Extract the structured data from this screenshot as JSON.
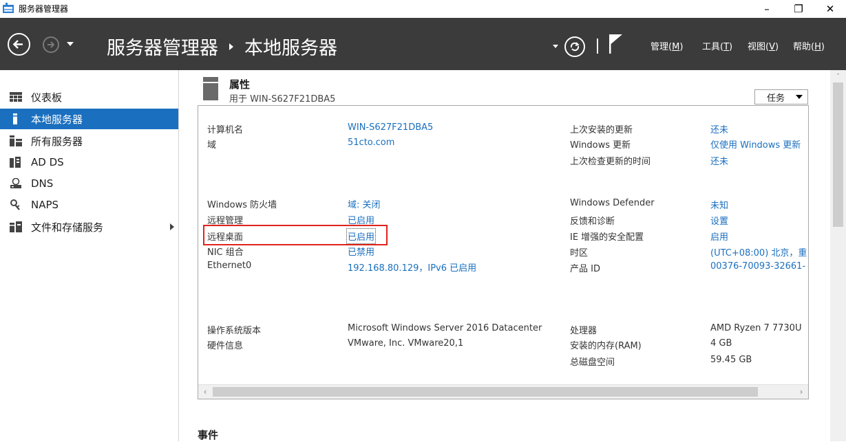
{
  "window": {
    "title": "服务器管理器",
    "controls": {
      "minimize": "–",
      "restore": "❐",
      "close": "✕"
    }
  },
  "header": {
    "breadcrumb_root": "服务器管理器",
    "breadcrumb_current": "本地服务器",
    "menus": [
      {
        "label": "管理",
        "key": "M"
      },
      {
        "label": "工具",
        "key": "T"
      },
      {
        "label": "视图",
        "key": "V"
      },
      {
        "label": "帮助",
        "key": "H"
      }
    ]
  },
  "sidebar": {
    "items": [
      {
        "label": "仪表板",
        "icon": "dashboard-icon"
      },
      {
        "label": "本地服务器",
        "icon": "local-server-icon",
        "active": true
      },
      {
        "label": "所有服务器",
        "icon": "all-servers-icon"
      },
      {
        "label": "AD DS",
        "icon": "adds-icon"
      },
      {
        "label": "DNS",
        "icon": "dns-icon"
      },
      {
        "label": "NAPS",
        "icon": "naps-icon"
      },
      {
        "label": "文件和存储服务",
        "icon": "file-storage-icon",
        "has_submenu": true
      }
    ]
  },
  "properties": {
    "title": "属性",
    "subtitle": "用于 WIN-S627F21DBA5",
    "tasks_label": "任务",
    "left": [
      {
        "label": "计算机名",
        "value": "WIN-S627F21DBA5",
        "link": true
      },
      {
        "label": "域",
        "value": "51cto.com",
        "link": true
      },
      {
        "label": "Windows 防火墙",
        "value": "域: 关闭",
        "link": true
      },
      {
        "label": "远程管理",
        "value": "已启用",
        "link": true
      },
      {
        "label": "远程桌面",
        "value": "已启用",
        "link": true,
        "highlighted": true
      },
      {
        "label": "NIC 组合",
        "value": "已禁用",
        "link": true
      },
      {
        "label": "Ethernet0",
        "value": "192.168.80.129，IPv6 已启用",
        "link": true
      },
      {
        "label": "操作系统版本",
        "value": "Microsoft Windows Server 2016 Datacenter",
        "link": false
      },
      {
        "label": "硬件信息",
        "value": "VMware, Inc. VMware20,1",
        "link": false
      }
    ],
    "right": [
      {
        "label": "上次安装的更新",
        "value": "还未",
        "link": true
      },
      {
        "label": "Windows 更新",
        "value": "仅使用 Windows 更新",
        "link": true
      },
      {
        "label": "上次检查更新的时间",
        "value": "还未",
        "link": true
      },
      {
        "label": "Windows Defender",
        "value": "未知",
        "link": true
      },
      {
        "label": "反馈和诊断",
        "value": "设置",
        "link": true
      },
      {
        "label": "IE 增强的安全配置",
        "value": "启用",
        "link": true
      },
      {
        "label": "时区",
        "value": "(UTC+08:00) 北京，重",
        "link": true
      },
      {
        "label": "产品 ID",
        "value": "00376-70093-32661-",
        "link": true
      },
      {
        "label": "处理器",
        "value": "AMD Ryzen 7 7730U",
        "link": false
      },
      {
        "label": "安装的内存(RAM)",
        "value": "4 GB",
        "link": false
      },
      {
        "label": "总磁盘空间",
        "value": "59.45 GB",
        "link": false
      }
    ]
  },
  "events": {
    "title": "事件"
  },
  "colors": {
    "header_bg": "#3b3b3b",
    "accent": "#1a6fbf",
    "highlight_border": "#e0231a"
  }
}
